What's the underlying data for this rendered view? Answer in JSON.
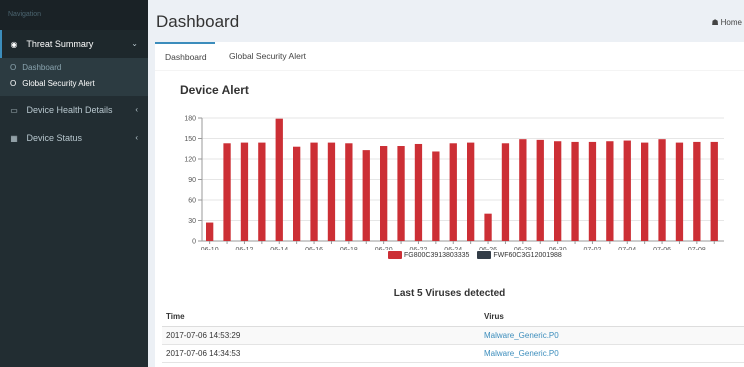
{
  "sidebar": {
    "header": "Navigation",
    "items": [
      {
        "label": "Threat Summary",
        "icon": "dashboard-icon"
      },
      {
        "label": "Device Health Details",
        "icon": "laptop-icon"
      },
      {
        "label": "Device Status",
        "icon": "grid-icon"
      }
    ],
    "submenu": [
      {
        "label": "Dashboard"
      },
      {
        "label": "Global Security Alert"
      }
    ]
  },
  "header": {
    "title": "Dashboard",
    "breadcrumb": "Home"
  },
  "tabs": [
    {
      "label": "Dashboard"
    },
    {
      "label": "Global Security Alert"
    }
  ],
  "section": {
    "title": "Device Alert"
  },
  "colors": {
    "bar": "#cc2f35",
    "series2": "#333d47",
    "sidebar": "#222d32",
    "accent": "#3c8dbc"
  },
  "chart_data": {
    "type": "bar",
    "title": "Device Alert",
    "xlabel": "",
    "ylabel": "",
    "ylim": [
      0,
      180
    ],
    "yticks": [
      0,
      30,
      60,
      90,
      120,
      150,
      180
    ],
    "grid": true,
    "legend_position": "bottom",
    "categories": [
      "06-10",
      "06-11",
      "06-12",
      "06-13",
      "06-14",
      "06-15",
      "06-16",
      "06-17",
      "06-18",
      "06-19",
      "06-20",
      "06-21",
      "06-22",
      "06-23",
      "06-24",
      "06-25",
      "06-26",
      "06-27",
      "06-28",
      "06-29",
      "06-30",
      "07-01",
      "07-02",
      "07-03",
      "07-04",
      "07-05",
      "07-06",
      "07-07",
      "07-08",
      "07-09"
    ],
    "xtick_labels": [
      "06-10",
      "06-12",
      "06-14",
      "06-16",
      "06-18",
      "06-20",
      "06-22",
      "06-24",
      "06-26",
      "06-28",
      "06-30",
      "07-02",
      "07-04",
      "07-06",
      "07-08"
    ],
    "series": [
      {
        "name": "FG800C3913803335",
        "color": "#cc2f35",
        "values": [
          27,
          143,
          144,
          144,
          179,
          138,
          144,
          144,
          143,
          133,
          139,
          139,
          142,
          131,
          143,
          144,
          40,
          143,
          149,
          148,
          146,
          145,
          145,
          146,
          147,
          144,
          149,
          144,
          145,
          145
        ]
      },
      {
        "name": "FWF60C3G12001988",
        "color": "#333d47",
        "values": [
          0,
          0,
          0,
          0,
          0,
          0,
          0,
          0,
          0,
          0,
          0,
          0,
          0,
          0,
          0,
          0,
          0,
          0,
          0,
          0,
          0,
          0,
          0,
          0,
          0,
          0,
          0,
          0,
          0,
          0
        ]
      }
    ]
  },
  "table": {
    "title": "Last 5 Viruses detected",
    "columns": [
      "Time",
      "Virus"
    ],
    "rows": [
      {
        "time": "2017-07-06 14:53:29",
        "virus": "Malware_Generic.P0"
      },
      {
        "time": "2017-07-06 14:34:53",
        "virus": "Malware_Generic.P0"
      }
    ]
  }
}
